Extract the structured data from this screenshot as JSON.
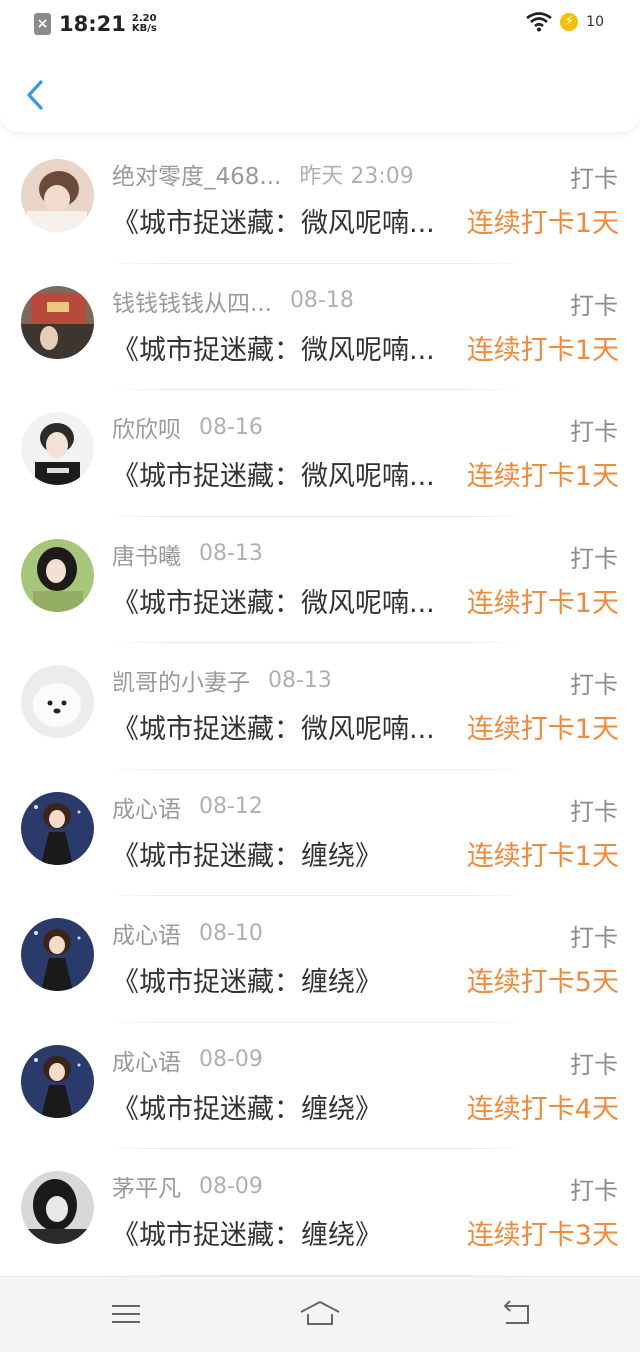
{
  "status_bar": {
    "time": "18:21",
    "speed_value": "2.20",
    "speed_unit": "KB/s",
    "battery": "10",
    "icons": [
      "sim-disabled-icon",
      "wifi-icon",
      "charging-bolt-icon",
      "battery-icon"
    ]
  },
  "header": {
    "back_icon": "chevron-left-icon"
  },
  "colors": {
    "accent": "#2f9be8",
    "streak": "#f08a3c",
    "muted": "#9a9a9a"
  },
  "items": [
    {
      "name": "绝对零度_468...",
      "date": "昨天 23:09",
      "type": "打卡",
      "title": "《城市捉迷藏：微风呢喃...",
      "streak": "连续打卡1天"
    },
    {
      "name": "钱钱钱钱从四...",
      "date": "08-18",
      "type": "打卡",
      "title": "《城市捉迷藏：微风呢喃...",
      "streak": "连续打卡1天"
    },
    {
      "name": "欣欣呗",
      "date": "08-16",
      "type": "打卡",
      "title": "《城市捉迷藏：微风呢喃...",
      "streak": "连续打卡1天"
    },
    {
      "name": "唐书曦",
      "date": "08-13",
      "type": "打卡",
      "title": "《城市捉迷藏：微风呢喃...",
      "streak": "连续打卡1天"
    },
    {
      "name": "凯哥的小妻子",
      "date": "08-13",
      "type": "打卡",
      "title": "《城市捉迷藏：微风呢喃...",
      "streak": "连续打卡1天"
    },
    {
      "name": "成心语",
      "date": "08-12",
      "type": "打卡",
      "title": "《城市捉迷藏：缠绕》",
      "streak": "连续打卡1天"
    },
    {
      "name": "成心语",
      "date": "08-10",
      "type": "打卡",
      "title": "《城市捉迷藏：缠绕》",
      "streak": "连续打卡5天"
    },
    {
      "name": "成心语",
      "date": "08-09",
      "type": "打卡",
      "title": "《城市捉迷藏：缠绕》",
      "streak": "连续打卡4天"
    },
    {
      "name": "茅平凡",
      "date": "08-09",
      "type": "打卡",
      "title": "《城市捉迷藏：缠绕》",
      "streak": "连续打卡3天"
    }
  ],
  "nav_bar": {
    "icons": [
      "menu-icon",
      "home-icon",
      "back-icon"
    ]
  }
}
